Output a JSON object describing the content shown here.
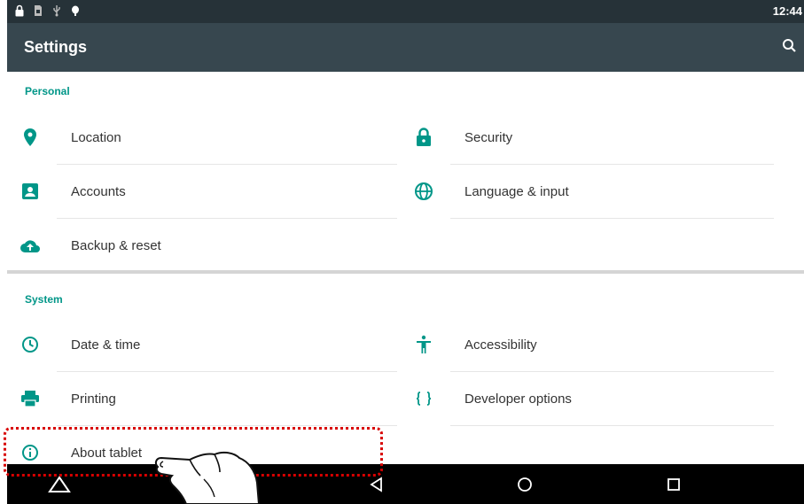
{
  "status_bar": {
    "icons": [
      "lock-icon",
      "sim-card-icon",
      "usb-icon",
      "debug-bug-icon"
    ],
    "time": "12:44"
  },
  "app_bar": {
    "title": "Settings",
    "search_icon": "search-icon"
  },
  "sections": [
    {
      "header": "Personal",
      "items": [
        {
          "label": "Location",
          "icon": "location-pin-icon"
        },
        {
          "label": "Security",
          "icon": "lock-icon"
        },
        {
          "label": "Accounts",
          "icon": "account-box-icon"
        },
        {
          "label": "Language & input",
          "icon": "globe-icon"
        },
        {
          "label": "Backup & reset",
          "icon": "cloud-upload-icon"
        }
      ]
    },
    {
      "header": "System",
      "items": [
        {
          "label": "Date & time",
          "icon": "clock-icon"
        },
        {
          "label": "Accessibility",
          "icon": "accessibility-icon"
        },
        {
          "label": "Printing",
          "icon": "printer-icon"
        },
        {
          "label": "Developer options",
          "icon": "braces-icon"
        },
        {
          "label": "About tablet",
          "icon": "info-icon"
        }
      ]
    }
  ],
  "nav_bar": {
    "icons": [
      "home-triangle-icon",
      "back-icon",
      "home-icon",
      "recents-icon"
    ]
  },
  "annotation": {
    "highlight_target": "About tablet",
    "highlight_color": "#d80000",
    "pointer": "tapping-hand-icon"
  },
  "colors": {
    "accent": "#009688",
    "status_bar": "#263238",
    "app_bar": "#37474f"
  }
}
